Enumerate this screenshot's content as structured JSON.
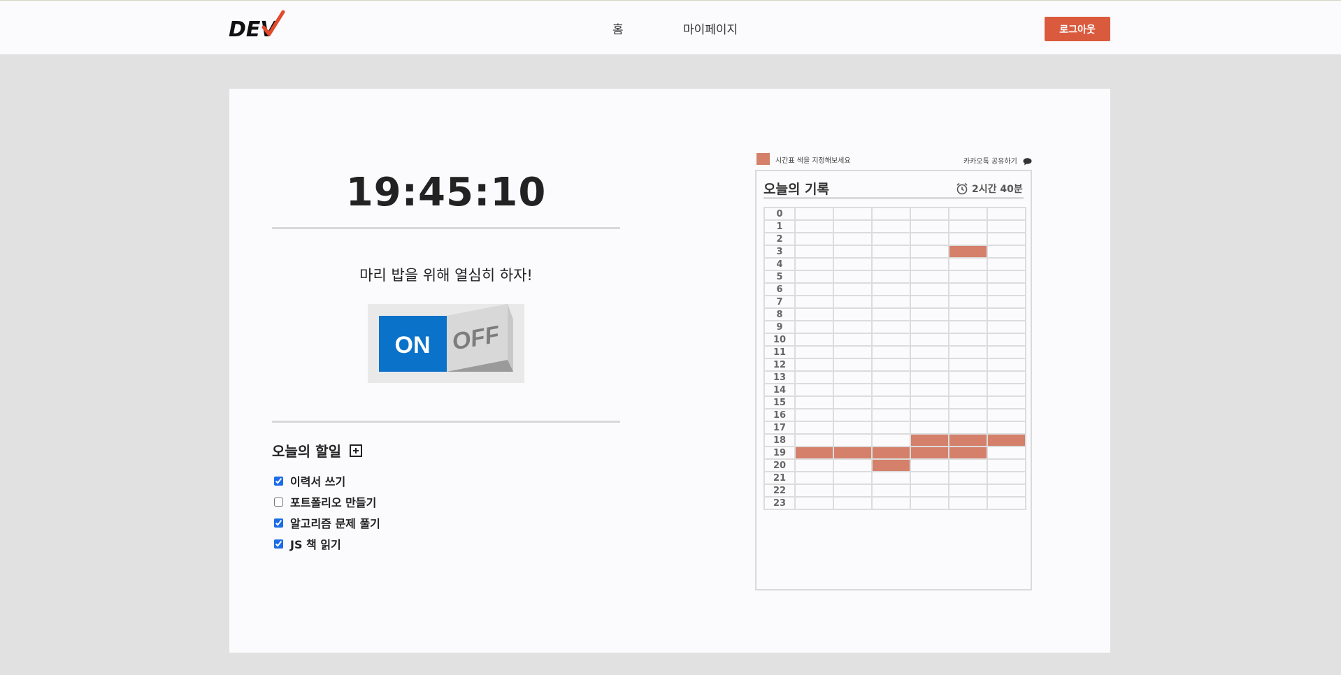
{
  "header": {
    "logo_text": "DEV",
    "nav": [
      {
        "label": "홈"
      },
      {
        "label": "마이페이지"
      }
    ],
    "logout_label": "로그아웃"
  },
  "timer": {
    "clock": "19:45:10",
    "motto": "마리 밥을 위해 열심히 하자!",
    "switch": {
      "on_label": "ON",
      "off_label": "OFF",
      "state": "on"
    }
  },
  "todo": {
    "title": "오늘의 할일",
    "items": [
      {
        "label": "이력서 쓰기",
        "checked": true
      },
      {
        "label": "포트폴리오 만들기",
        "checked": false
      },
      {
        "label": "알고리즘 문제 풀기",
        "checked": true
      },
      {
        "label": "JS 책 읽기",
        "checked": true
      }
    ]
  },
  "timetable": {
    "color_hint": "시간표 색을 지정해보세요",
    "share_label": "카카오톡 공유하기",
    "title": "오늘의 기록",
    "total": "2시간 40분",
    "highlight_color": "#d4806b",
    "hours": [
      "0",
      "1",
      "2",
      "3",
      "4",
      "5",
      "6",
      "7",
      "8",
      "9",
      "10",
      "11",
      "12",
      "13",
      "14",
      "15",
      "16",
      "17",
      "18",
      "19",
      "20",
      "21",
      "22",
      "23"
    ],
    "filled": {
      "3": [
        4
      ],
      "18": [
        3,
        4,
        5
      ],
      "19": [
        0,
        1,
        2,
        3,
        4
      ],
      "20": [
        2
      ]
    }
  },
  "colors": {
    "accent": "#da5a3e",
    "switch_on": "#0a72c9",
    "page_bg": "#e1e1e1",
    "card_bg": "#fbfafc"
  }
}
